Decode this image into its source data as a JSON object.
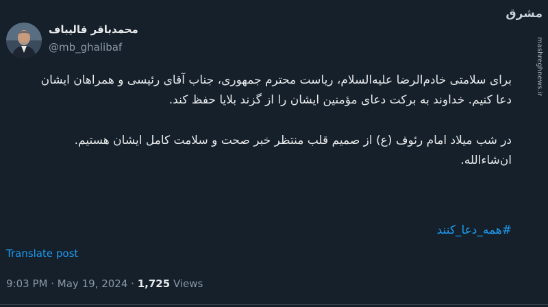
{
  "author": {
    "display_name": "محمدباقر قالیباف",
    "handle": "@mb_ghalibaf"
  },
  "watermark": {
    "logo_text": "مشرق",
    "site": "mashreghnews.ir"
  },
  "tweet": {
    "paragraph_1": "برای سلامتی خادم‌الرضا علیه‌السلام، ریاست محترم جمهوری، جناب آقای رئیسی و همراهان ایشان دعا کنیم. خداوند به برکت دعای مؤمنین ایشان را از گزند بلایا حفظ کند.",
    "paragraph_2": "در شب میلاد امام رئوف (ع) از صمیم قلب منتظر خبر صحت و سلامت کامل ایشان هستیم. ان‌شاءالله.",
    "hashtag": "#همه_دعا_کنند"
  },
  "translate_label": "Translate post",
  "meta": {
    "time": "9:03 PM",
    "date": "May 19, 2024",
    "separator": "·",
    "views_count": "1,725",
    "views_label": "Views"
  }
}
